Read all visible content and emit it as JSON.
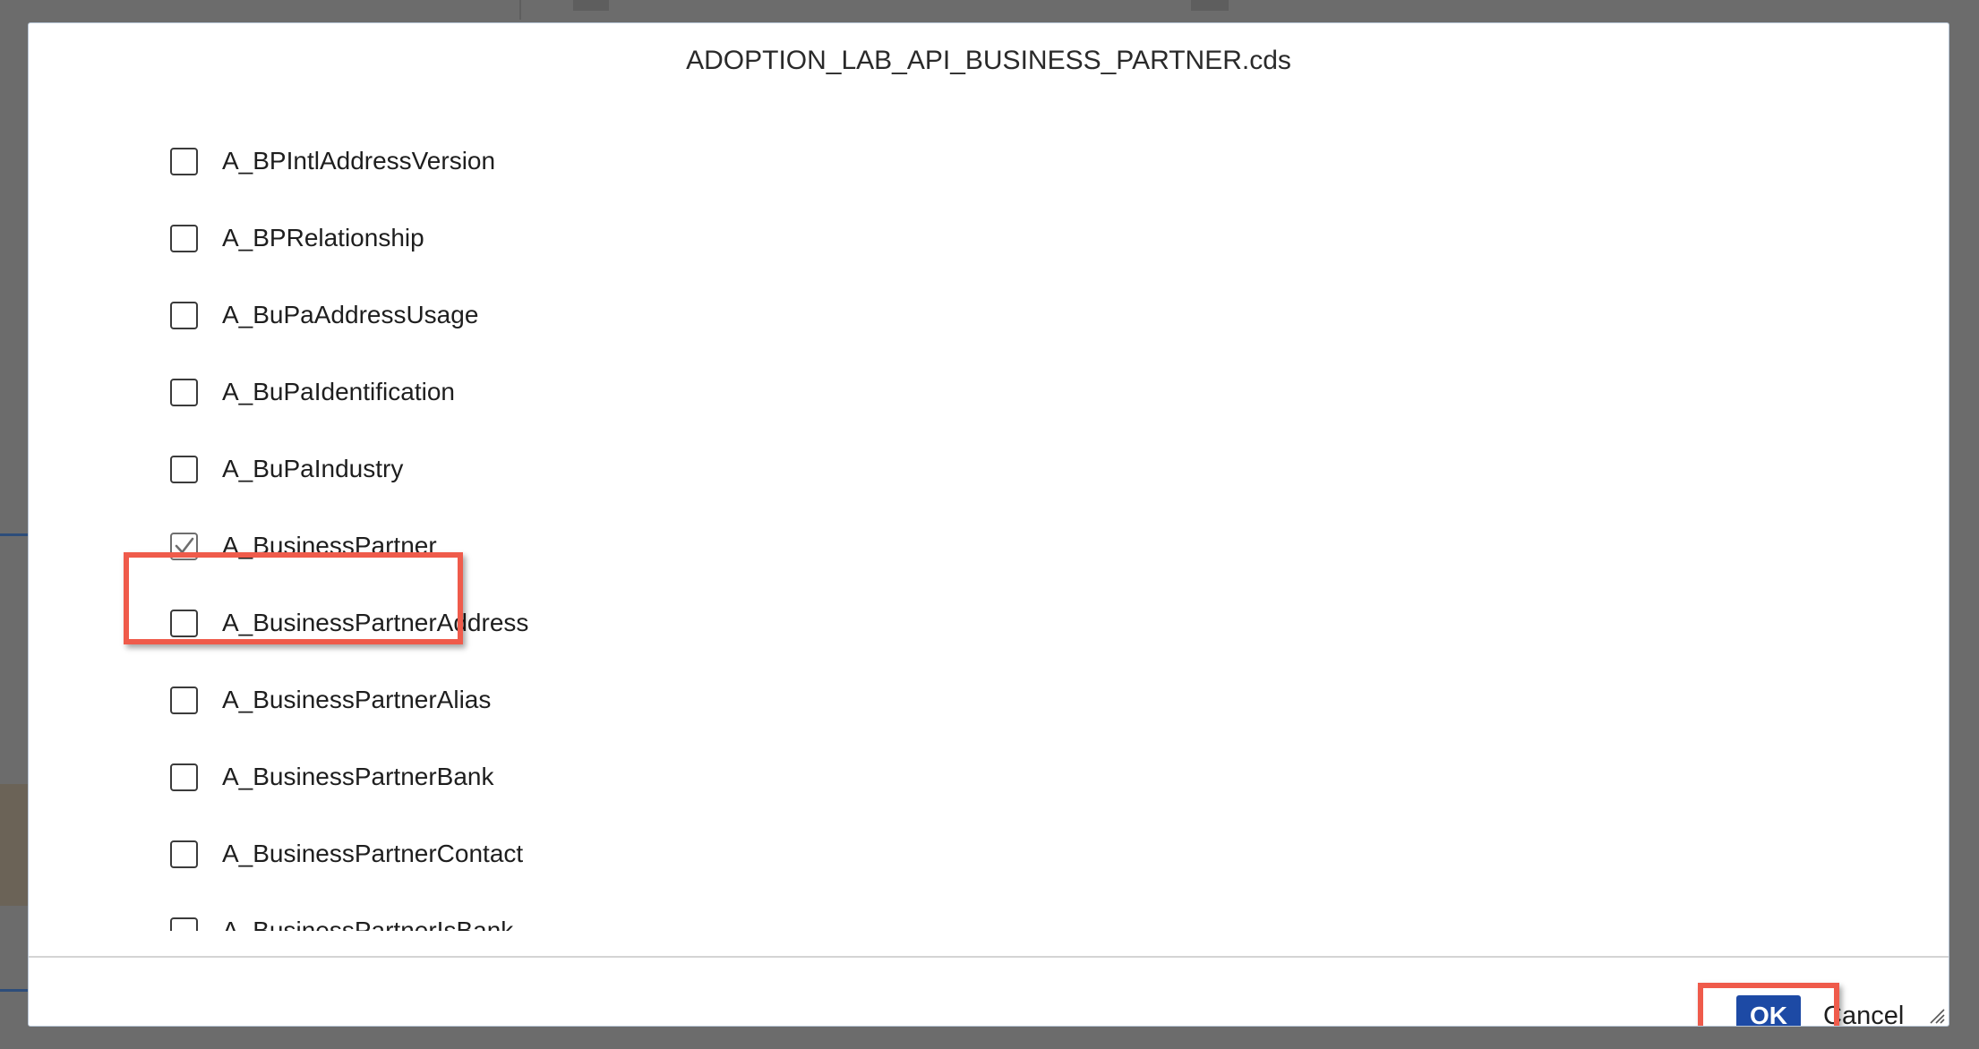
{
  "dialog": {
    "title": "ADOPTION_LAB_API_BUSINESS_PARTNER.cds",
    "items": [
      {
        "label": "A_BPIntlAddressVersion",
        "checked": false
      },
      {
        "label": "A_BPRelationship",
        "checked": false
      },
      {
        "label": "A_BuPaAddressUsage",
        "checked": false
      },
      {
        "label": "A_BuPaIdentification",
        "checked": false
      },
      {
        "label": "A_BuPaIndustry",
        "checked": false
      },
      {
        "label": "A_BusinessPartner",
        "checked": true
      },
      {
        "label": "A_BusinessPartnerAddress",
        "checked": false
      },
      {
        "label": "A_BusinessPartnerAlias",
        "checked": false
      },
      {
        "label": "A_BusinessPartnerBank",
        "checked": false
      },
      {
        "label": "A_BusinessPartnerContact",
        "checked": false
      },
      {
        "label": "A_BusinessPartnerIsBank",
        "checked": false
      }
    ],
    "footer": {
      "ok_label": "OK",
      "cancel_label": "Cancel"
    }
  },
  "colors": {
    "highlight": "#ef5b4b",
    "ok_button": "#1d4aa5",
    "backdrop": "#6c6c6c"
  },
  "icons": {
    "checkmark": "checkmark-icon",
    "resize": "resize-grip-icon"
  }
}
